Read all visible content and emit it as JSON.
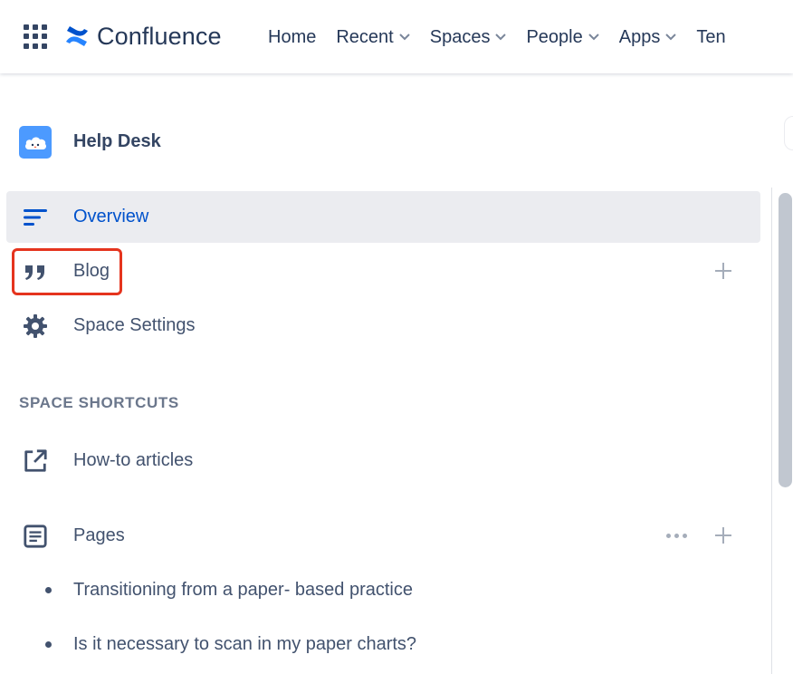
{
  "app": {
    "name": "Confluence",
    "brand_color": "#2684FF"
  },
  "nav": {
    "items": [
      {
        "label": "Home",
        "has_dropdown": false
      },
      {
        "label": "Recent",
        "has_dropdown": true
      },
      {
        "label": "Spaces",
        "has_dropdown": true
      },
      {
        "label": "People",
        "has_dropdown": true
      },
      {
        "label": "Apps",
        "has_dropdown": true
      },
      {
        "label": "Ten",
        "has_dropdown": false
      }
    ]
  },
  "space": {
    "name": "Help Desk",
    "avatar_icon": "cloud-icon"
  },
  "sidebar": {
    "items": [
      {
        "label": "Overview",
        "icon": "overview-lines-icon",
        "active": true
      },
      {
        "label": "Blog",
        "icon": "quote-icon",
        "highlighted": true
      },
      {
        "label": "Space Settings",
        "icon": "gear-icon"
      }
    ],
    "shortcuts_title": "SPACE SHORTCUTS",
    "shortcuts": [
      {
        "label": "How-to articles",
        "icon": "external-link-icon"
      }
    ],
    "pages": {
      "label": "Pages",
      "icon": "page-icon",
      "children": [
        "Transitioning from a paper- based practice",
        "Is it necessary to scan in my paper charts?"
      ]
    }
  },
  "colors": {
    "highlight_border": "#E5341E",
    "active_text": "#0052CC",
    "active_bg": "#EBECF0"
  }
}
